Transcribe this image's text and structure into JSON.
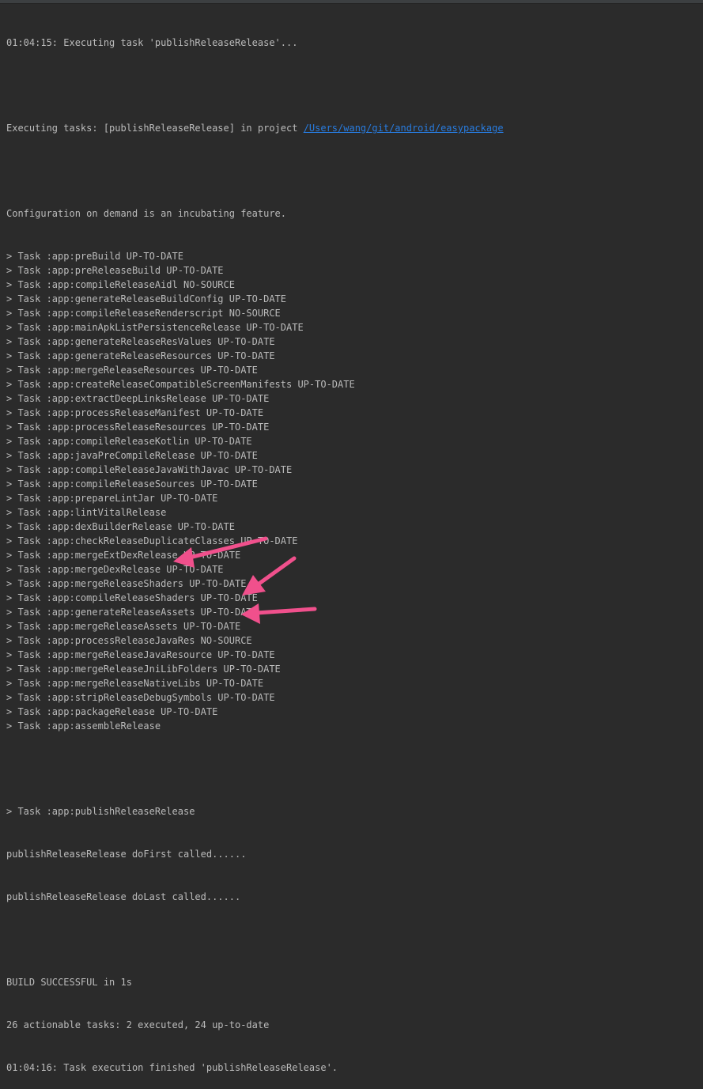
{
  "console": {
    "header_line": "01:04:15: Executing task 'publishReleaseRelease'...",
    "executing_prefix": "Executing tasks: [publishReleaseRelease] in project ",
    "project_path": "/Users/wang/git/android/easypackage",
    "config_line": "Configuration on demand is an incubating feature.",
    "task_lines": [
      "> Task :app:preBuild UP-TO-DATE",
      "> Task :app:preReleaseBuild UP-TO-DATE",
      "> Task :app:compileReleaseAidl NO-SOURCE",
      "> Task :app:generateReleaseBuildConfig UP-TO-DATE",
      "> Task :app:compileReleaseRenderscript NO-SOURCE",
      "> Task :app:mainApkListPersistenceRelease UP-TO-DATE",
      "> Task :app:generateReleaseResValues UP-TO-DATE",
      "> Task :app:generateReleaseResources UP-TO-DATE",
      "> Task :app:mergeReleaseResources UP-TO-DATE",
      "> Task :app:createReleaseCompatibleScreenManifests UP-TO-DATE",
      "> Task :app:extractDeepLinksRelease UP-TO-DATE",
      "> Task :app:processReleaseManifest UP-TO-DATE",
      "> Task :app:processReleaseResources UP-TO-DATE",
      "> Task :app:compileReleaseKotlin UP-TO-DATE",
      "> Task :app:javaPreCompileRelease UP-TO-DATE",
      "> Task :app:compileReleaseJavaWithJavac UP-TO-DATE",
      "> Task :app:compileReleaseSources UP-TO-DATE",
      "> Task :app:prepareLintJar UP-TO-DATE",
      "> Task :app:lintVitalRelease",
      "> Task :app:dexBuilderRelease UP-TO-DATE",
      "> Task :app:checkReleaseDuplicateClasses UP-TO-DATE",
      "> Task :app:mergeExtDexRelease UP-TO-DATE",
      "> Task :app:mergeDexRelease UP-TO-DATE",
      "> Task :app:mergeReleaseShaders UP-TO-DATE",
      "> Task :app:compileReleaseShaders UP-TO-DATE",
      "> Task :app:generateReleaseAssets UP-TO-DATE",
      "> Task :app:mergeReleaseAssets UP-TO-DATE",
      "> Task :app:processReleaseJavaRes NO-SOURCE",
      "> Task :app:mergeReleaseJavaResource UP-TO-DATE",
      "> Task :app:mergeReleaseJniLibFolders UP-TO-DATE",
      "> Task :app:mergeReleaseNativeLibs UP-TO-DATE",
      "> Task :app:stripReleaseDebugSymbols UP-TO-DATE",
      "> Task :app:packageRelease UP-TO-DATE",
      "> Task :app:assembleRelease"
    ],
    "publish_task_line": "> Task :app:publishReleaseRelease",
    "do_first_line": "publishReleaseRelease doFirst called......",
    "do_last_line": "publishReleaseRelease doLast called......",
    "build_result": "BUILD SUCCESSFUL in 1s",
    "actionable_summary": "26 actionable tasks: 2 executed, 24 up-to-date",
    "footer_line": "01:04:16: Task execution finished 'publishReleaseRelease'."
  },
  "colors": {
    "background": "#2b2b2b",
    "text": "#bbbbbb",
    "link": "#287bde",
    "arrow": "#f0508c"
  },
  "annotations": {
    "arrow_icon": "pink-arrow-icon"
  }
}
